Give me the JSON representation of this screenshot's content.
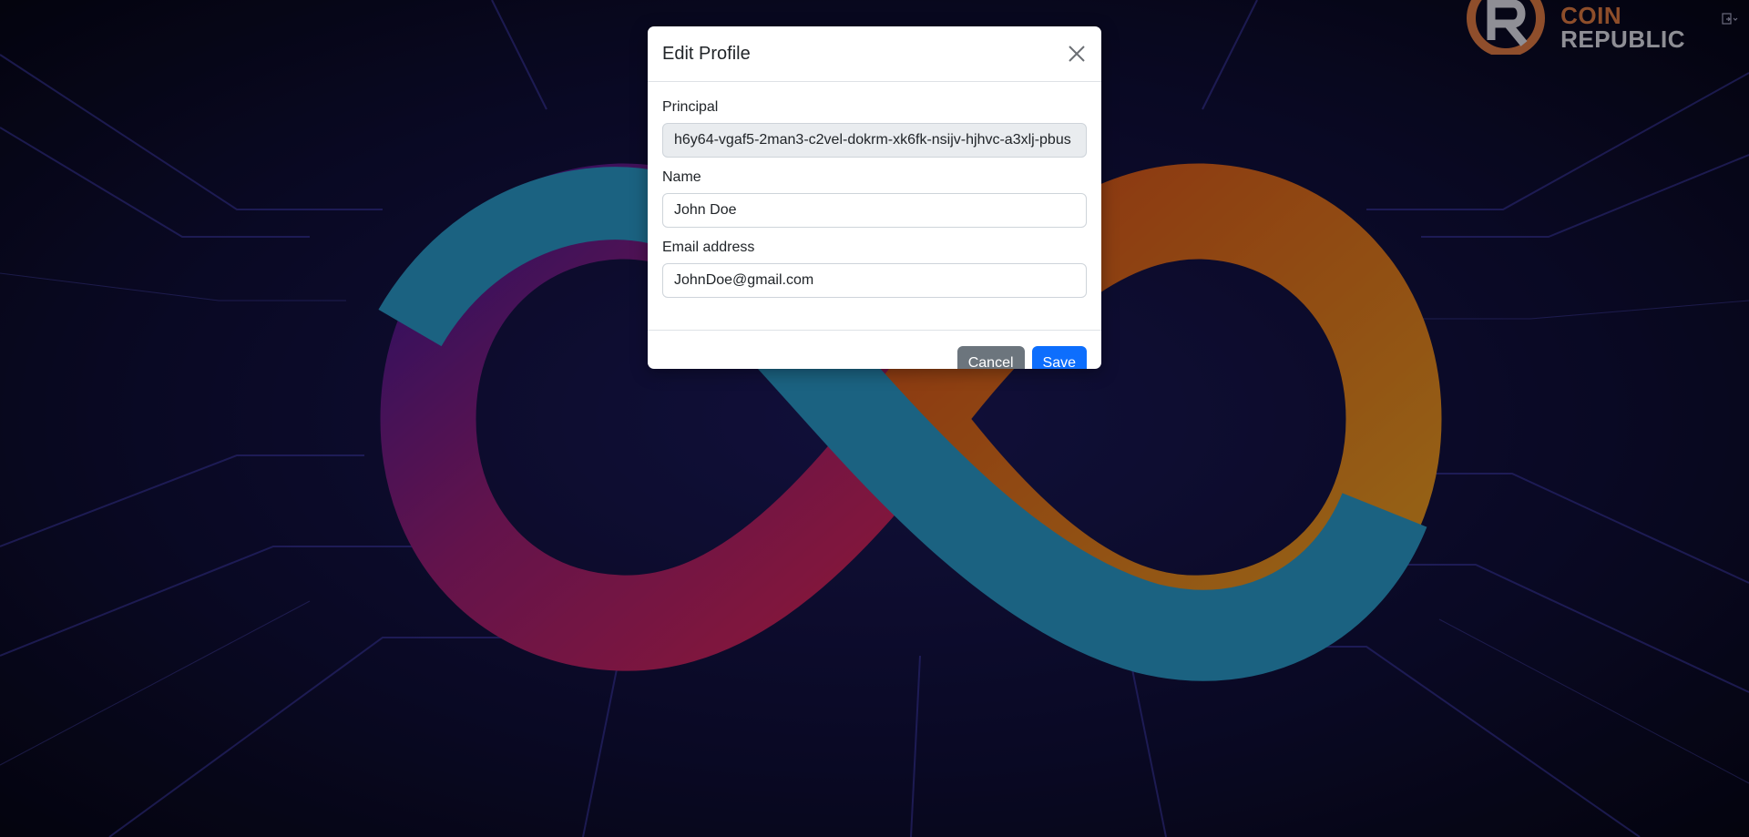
{
  "brand": {
    "line1": "COIN",
    "line2": "REPUBLIC",
    "icon": "coin-republic-logo"
  },
  "modal": {
    "title": "Edit Profile",
    "close_icon": "close-icon",
    "fields": {
      "principal": {
        "label": "Principal",
        "value": "h6y64-vgaf5-2man3-c2vel-dokrm-xk6fk-nsijv-hjhvc-a3xlj-pbus"
      },
      "name": {
        "label": "Name",
        "value": "John Doe"
      },
      "email": {
        "label": "Email address",
        "value": "JohnDoe@gmail.com"
      }
    },
    "buttons": {
      "cancel": "Cancel",
      "save": "Save"
    }
  },
  "colors": {
    "primary": "#0d6efd",
    "secondary": "#6c757d",
    "background": "#0a0a26"
  }
}
